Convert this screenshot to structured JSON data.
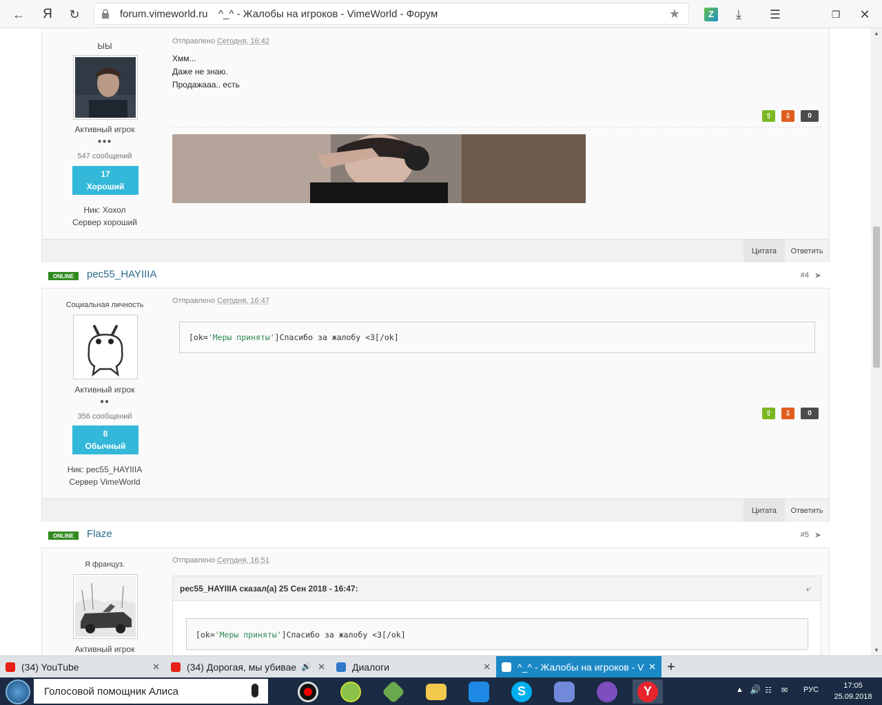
{
  "browser": {
    "domain": "forum.vimeworld.ru",
    "title": "^_^ - Жалобы на игроков - VimeWorld - Форум",
    "yandex_glyph": "Я"
  },
  "posts": [
    {
      "sidebar": {
        "custom_title": "ЫЫ",
        "rank": "Активный игрок",
        "pips": "●●●",
        "messages": "547 сообщений",
        "rep_count": "17",
        "rep_label": "Хороший",
        "nick": "Ник: Хохол",
        "server": "Сервер хороший"
      },
      "posted_prefix": "Отправлено",
      "posted_date": "Сегодня, 16:42",
      "body_lines": [
        "Хмм...",
        "Даже не знаю.",
        "Продажааа.. есть"
      ],
      "vote_count": "0",
      "quote_label": "Цитата",
      "reply_label": "Ответить"
    },
    {
      "online": "ONLINE",
      "username": "рес55_HAYIIIA",
      "post_number": "#4",
      "sidebar": {
        "custom_title": "Социальная личность",
        "rank": "Активный игрок",
        "pips": "●●",
        "messages": "356 сообщений",
        "rep_count": "8",
        "rep_label": "Обычный",
        "nick": "Ник: рес55_HAYIIIA",
        "server": "Сервер VimeWorld"
      },
      "posted_prefix": "Отправлено",
      "posted_date": "Сегодня, 16:47",
      "code": {
        "pre": "[ok=",
        "str": "'Меры приняты'",
        "post": "]Спасибо за жалобу <3[/ok]"
      },
      "vote_count": "0",
      "quote_label": "Цитата",
      "reply_label": "Ответить"
    },
    {
      "online": "ONLINE",
      "username": "Flaze",
      "post_number": "#5",
      "sidebar": {
        "custom_title": "Я француз.",
        "rank": "Активный игрок"
      },
      "posted_prefix": "Отправлено",
      "posted_date": "Сегодня, 16:51",
      "quote_header": "рес55_HAYIIIA сказал(а) 25 Сен 2018 - 16:47:",
      "code": {
        "pre": "[ok=",
        "str": "'Меры приняты'",
        "post": "]Спасибо за жалобу <3[/ok]"
      }
    }
  ],
  "tabs": [
    {
      "label": "(34) YouTube",
      "active": false
    },
    {
      "label": "(34) Дорогая, мы убиваем",
      "active": false
    },
    {
      "label": "Диалоги",
      "active": false
    },
    {
      "label": "^_^ - Жалобы на игроков - V",
      "active": true
    }
  ],
  "taskbar": {
    "alice_label": "Голосовой помощник Алиса",
    "language": "РУС",
    "time": "17:05",
    "date": "25.09.2018"
  }
}
